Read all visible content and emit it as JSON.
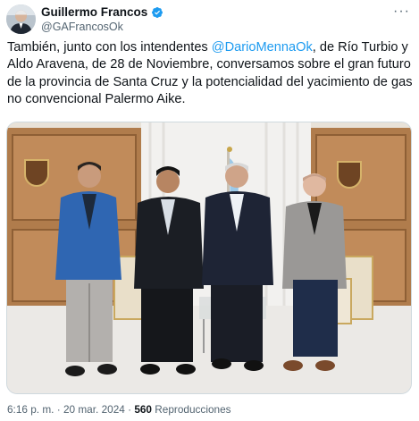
{
  "author": {
    "name": "Guillermo Francos",
    "handle": "@GAFrancosOk",
    "verified": true,
    "avatar": "avatar-photo"
  },
  "menu": {
    "icon": "more-icon",
    "glyph": "···"
  },
  "tweet": {
    "text_before": "También, junto con los intendentes ",
    "mention": "@DarioMennaOk",
    "text_after": ", de Río Turbio y Aldo Aravena, de 28 de Noviembre, conversamos sobre el gran futuro de la provincia de Santa Cruz y la potencialidad del yacimiento de gas no convencional Palermo Aike."
  },
  "media": {
    "type": "photo"
  },
  "meta": {
    "time": "6:16 p. m.",
    "separator": " · ",
    "date": "20 mar. 2024",
    "views_count": "560",
    "views_label": "Reproducciones"
  },
  "colors": {
    "accent": "#1d9bf0",
    "text": "#0f1419",
    "muted": "#536471"
  }
}
